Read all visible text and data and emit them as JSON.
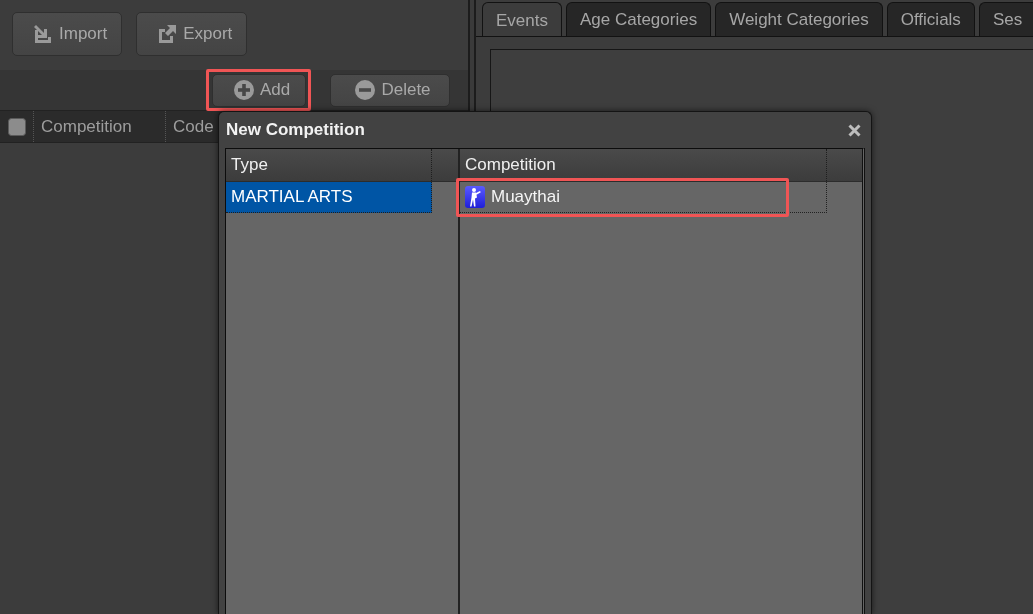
{
  "toolbar": {
    "buttons": [
      {
        "label": "Import",
        "kind": "import"
      },
      {
        "label": "Export",
        "kind": "export"
      }
    ]
  },
  "action_bar": {
    "buttons": [
      {
        "label": "Add",
        "kind": "add",
        "highlighted": true
      },
      {
        "label": "Delete",
        "kind": "delete",
        "highlighted": false
      }
    ]
  },
  "competition_table": {
    "select_all_checked": false,
    "columns": [
      "Competition",
      "Code"
    ]
  },
  "tabs": [
    {
      "label": "Events",
      "selected": true
    },
    {
      "label": "Age Categories",
      "selected": false
    },
    {
      "label": "Weight Categories",
      "selected": false
    },
    {
      "label": "Officials",
      "selected": false
    },
    {
      "label": "Ses",
      "selected": false
    }
  ],
  "dialog": {
    "title": "New Competition",
    "type_grid": {
      "columns": [
        "Type"
      ],
      "rows": [
        {
          "type": "MARTIAL ARTS",
          "selected": true
        }
      ]
    },
    "competition_grid": {
      "columns": [
        "Competition"
      ],
      "rows": [
        {
          "competition": "Muaythai",
          "focused": true,
          "highlighted": true
        }
      ]
    }
  }
}
